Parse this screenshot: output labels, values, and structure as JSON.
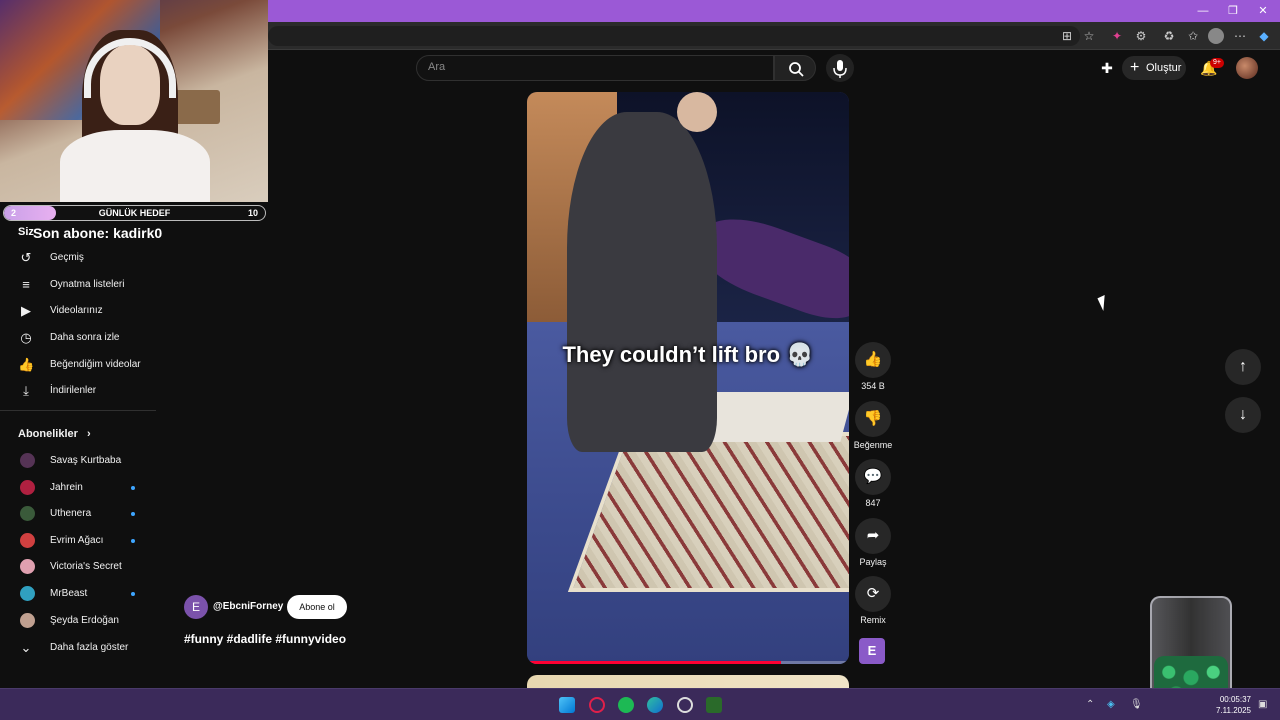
{
  "youtube": {
    "search_placeholder": "Ara",
    "create_label": "Oluştur",
    "notif_count": "9+"
  },
  "stream_overlay": {
    "goal_current": "2",
    "goal_label": "GÜNLÜK HEDEF",
    "goal_target": "10",
    "goal_progress": 0.2,
    "last_sub": "Son abone: kadirk0",
    "siz": "Siz"
  },
  "sidebar": {
    "you_items": [
      {
        "label": "Geçmiş",
        "icon": "history-icon"
      },
      {
        "label": "Oynatma listeleri",
        "icon": "playlists-icon"
      },
      {
        "label": "Videolarınız",
        "icon": "your-videos-icon"
      },
      {
        "label": "Daha sonra izle",
        "icon": "watch-later-icon"
      },
      {
        "label": "Beğendiğim videolar",
        "icon": "thumbs-up-icon"
      },
      {
        "label": "İndirilenler",
        "icon": "download-icon"
      }
    ],
    "subscriptions_title": "Abonelikler",
    "subscriptions": [
      {
        "name": "Savaş Kurtbaba",
        "color": "#553355",
        "live": false
      },
      {
        "name": "Jahrein",
        "color": "#b02040",
        "live": true
      },
      {
        "name": "Uthenera",
        "color": "#3a5a3a",
        "live": true
      },
      {
        "name": "Evrim Ağacı",
        "color": "#d04040",
        "live": true
      },
      {
        "name": "Victoria's Secret",
        "color": "#e0a0b0",
        "live": false
      },
      {
        "name": "MrBeast",
        "color": "#30a0c0",
        "live": true
      },
      {
        "name": "Şeyda Erdoğan",
        "color": "#c0a090",
        "live": false
      }
    ],
    "show_more": "Daha fazla göster"
  },
  "short": {
    "caption": "They couldn’t lift bro 💀",
    "progress": 0.79,
    "channel_initial": "E",
    "channel_handle": "@EbcniForney",
    "subscribe_label": "Abone ol",
    "hashtags": "#funny #dadlife #funnyvideo",
    "likes": "354 B",
    "dislike_label": "Beğenme",
    "comments": "847",
    "share_label": "Paylaş",
    "remix_label": "Remix",
    "badge_initial": "E"
  },
  "taskbar": {
    "time": "00:05:37",
    "date": "7.11.2025"
  }
}
